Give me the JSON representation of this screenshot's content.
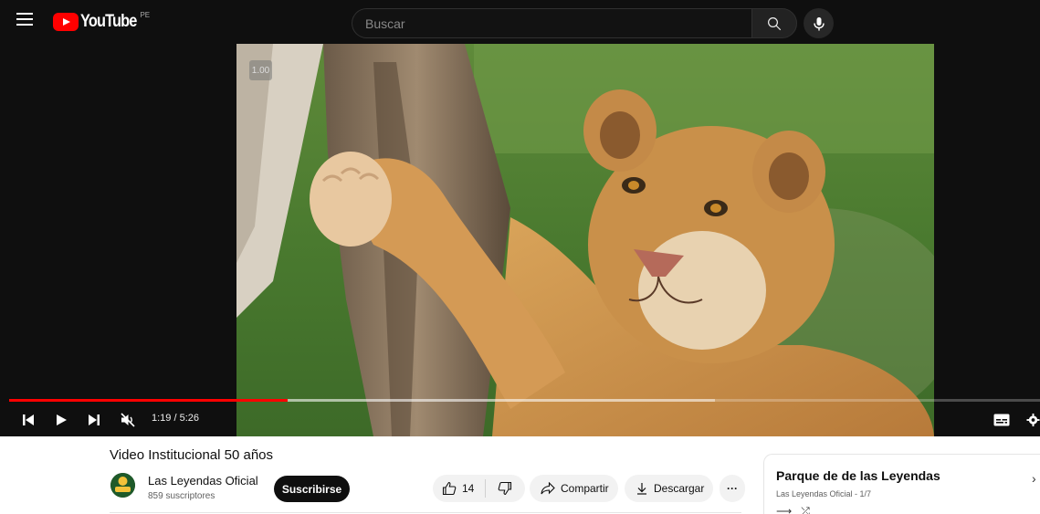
{
  "masthead": {
    "logo_text": "YouTube",
    "region": "PE",
    "search_placeholder": "Buscar"
  },
  "player": {
    "speed_badge": "1.00",
    "time_display": "1:19 / 5:26",
    "progress_played_fraction": 0.27,
    "progress_loaded_fraction": 0.685
  },
  "video": {
    "title": "Video Institucional 50 años",
    "channel_name": "Las Leyendas Oficial",
    "subscribers": "859 suscriptores",
    "subscribe_label": "Suscribirse",
    "like_count": "14",
    "share_label": "Compartir",
    "download_label": "Descargar",
    "more_label": "···"
  },
  "playlist": {
    "title": "Parque de de las Leyendas",
    "subtitle": "Las Leyendas Oficial - 1/7"
  },
  "colors": {
    "accent": "#ff0000",
    "masthead_bg": "#0f0f0f",
    "pill_bg": "#f2f2f2"
  }
}
